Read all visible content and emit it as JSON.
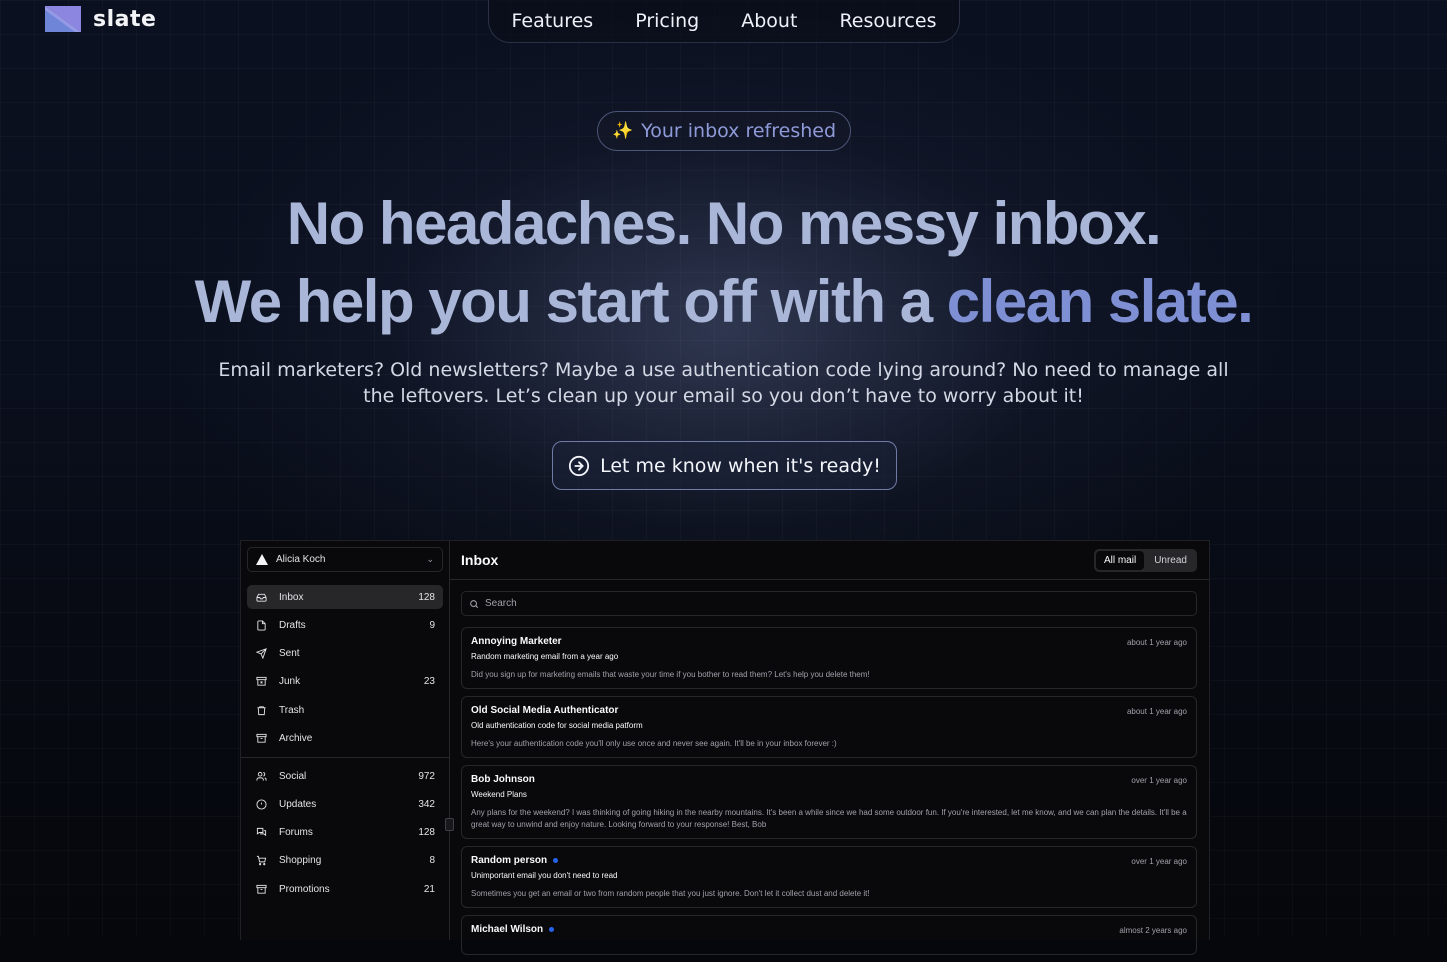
{
  "brand": {
    "name": "slate"
  },
  "nav": {
    "items": [
      "Features",
      "Pricing",
      "About",
      "Resources"
    ]
  },
  "hero": {
    "badge_icon": "sparkles",
    "badge": "Your inbox refreshed",
    "headline_line1": "No headaches. No messy inbox.",
    "headline_line2_prefix": "We help you start off with a",
    "headline_line2_accent": "clean slate.",
    "subtitle": "Email marketers? Old newsletters? Maybe a use authentication code lying around? No need to manage all the leftovers. Let’s clean up your email so you don’t have to worry about it!",
    "cta_label": "Let me know when it's ready!",
    "cta_icon": "arrow-right-circle-icon"
  },
  "app": {
    "account": "Alicia Koch",
    "folders": [
      {
        "label": "Inbox",
        "count": "128",
        "icon": "inbox"
      },
      {
        "label": "Drafts",
        "count": "9",
        "icon": "file"
      },
      {
        "label": "Sent",
        "count": "",
        "icon": "send"
      },
      {
        "label": "Junk",
        "count": "23",
        "icon": "archive-x"
      },
      {
        "label": "Trash",
        "count": "",
        "icon": "trash"
      },
      {
        "label": "Archive",
        "count": "",
        "icon": "archive"
      }
    ],
    "categories": [
      {
        "label": "Social",
        "count": "972",
        "icon": "users"
      },
      {
        "label": "Updates",
        "count": "342",
        "icon": "alert-circle"
      },
      {
        "label": "Forums",
        "count": "128",
        "icon": "messages"
      },
      {
        "label": "Shopping",
        "count": "8",
        "icon": "cart"
      },
      {
        "label": "Promotions",
        "count": "21",
        "icon": "archive"
      }
    ],
    "main_title": "Inbox",
    "tabs": [
      "All mail",
      "Unread"
    ],
    "search_placeholder": "Search",
    "mails": [
      {
        "from": "Annoying Marketer",
        "unread": false,
        "time": "about 1 year ago",
        "subject": "Random marketing email from a year ago",
        "preview": "Did you sign up for marketing emails that waste your time if you bother to read them? Let's help you delete them!"
      },
      {
        "from": "Old Social Media Authenticator",
        "unread": false,
        "time": "about 1 year ago",
        "subject": "Old authentication code for social media patform",
        "preview": "Here's your authentication code you'll only use once and never see again. It'll be in your inbox forever :)"
      },
      {
        "from": "Bob Johnson",
        "unread": false,
        "time": "over 1 year ago",
        "subject": "Weekend Plans",
        "preview": "Any plans for the weekend? I was thinking of going hiking in the nearby mountains. It's been a while since we had some outdoor fun. If you're interested, let me know, and we can plan the details. It'll be a great way to unwind and enjoy nature. Looking forward to your response! Best, Bob"
      },
      {
        "from": "Random person",
        "unread": true,
        "time": "over 1 year ago",
        "subject": "Unimportant email you don't need to read",
        "preview": "Sometimes you get an email or two from random people that you just ignore. Don't let it collect dust and delete it!"
      },
      {
        "from": "Michael Wilson",
        "unread": true,
        "time": "almost 2 years ago",
        "subject": "",
        "preview": ""
      }
    ]
  }
}
